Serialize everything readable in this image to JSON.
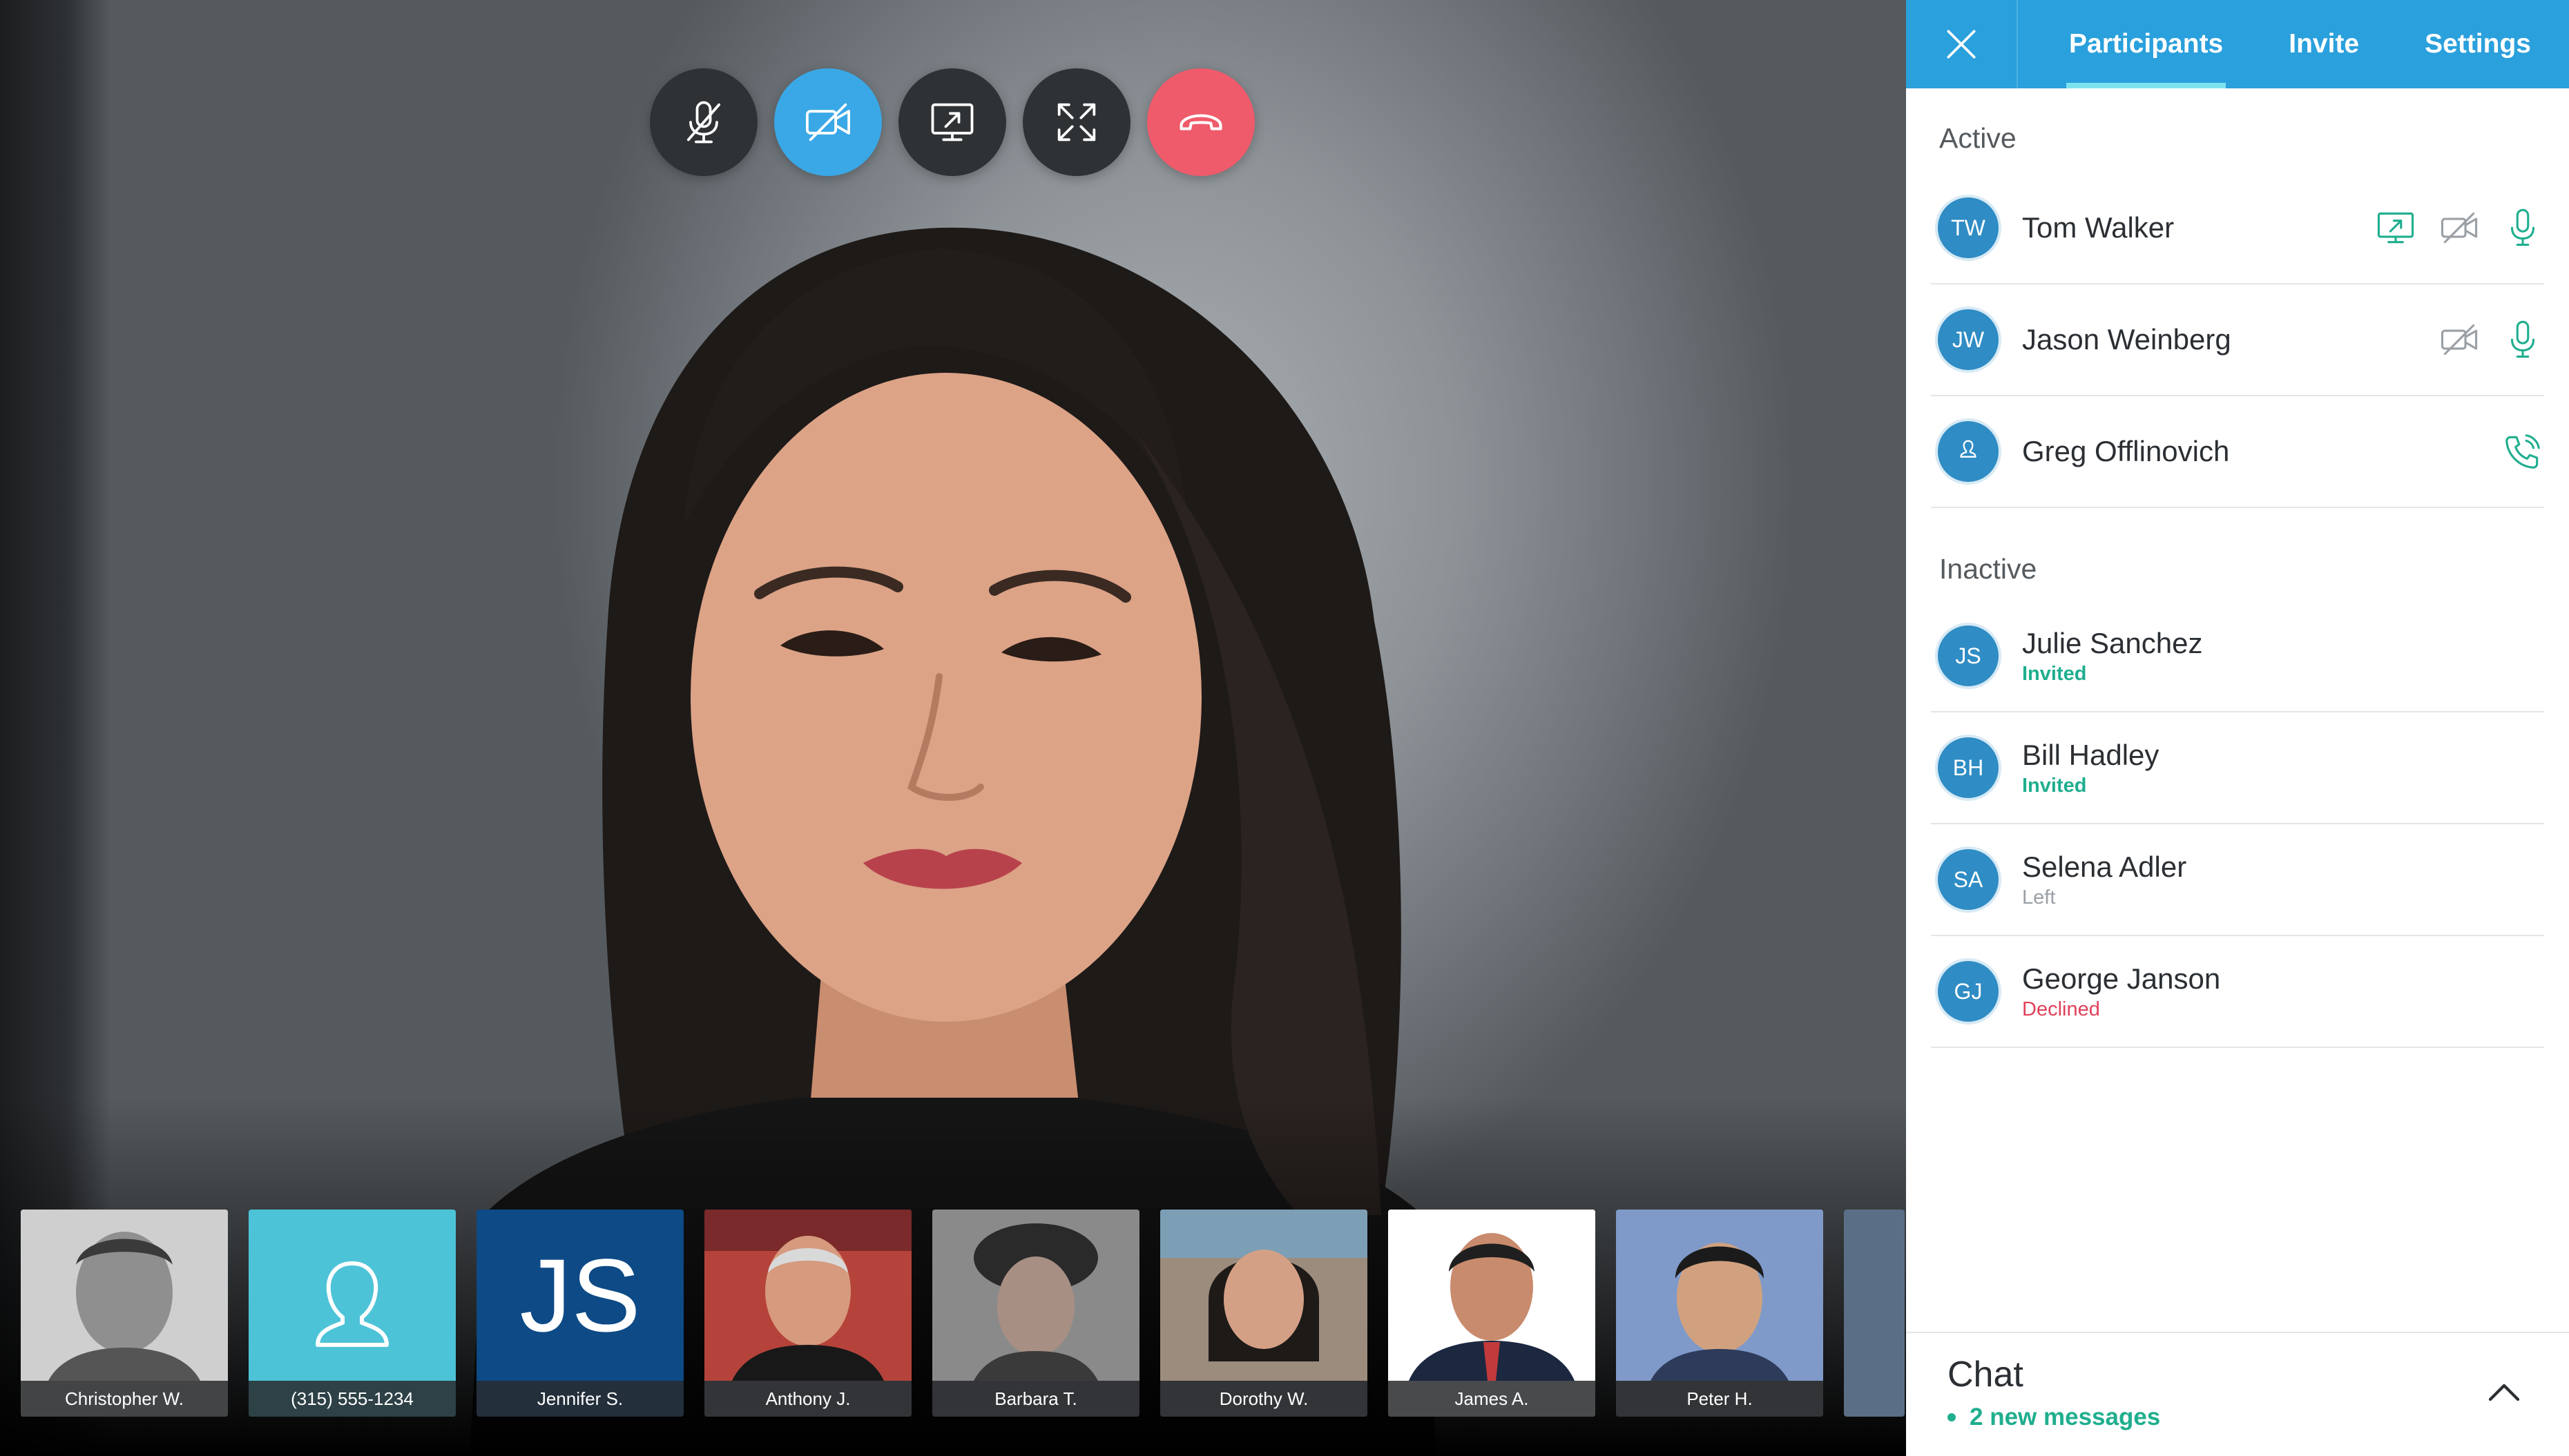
{
  "colors": {
    "accent": "#2aa0dc",
    "active_control": "#3aa8e6",
    "hangup": "#ef5b6b",
    "status_invited": "#1fae8e",
    "status_declined": "#e0415a",
    "status_left": "#9aa0a5",
    "mic_green": "#1fae8e"
  },
  "call_controls": [
    {
      "icon": "mic-off-icon",
      "state": "inactive"
    },
    {
      "icon": "camera-off-icon",
      "state": "active"
    },
    {
      "icon": "screen-share-icon",
      "state": "inactive"
    },
    {
      "icon": "fullscreen-icon",
      "state": "inactive"
    },
    {
      "icon": "hangup-icon",
      "state": "hangup"
    }
  ],
  "thumbnails": [
    {
      "label": "Christopher W.",
      "type": "photo"
    },
    {
      "label": "(315) 555-1234",
      "type": "phone",
      "icon": "user-outline-icon"
    },
    {
      "label": "Jennifer S.",
      "type": "initials",
      "initials": "JS"
    },
    {
      "label": "Anthony J.",
      "type": "photo"
    },
    {
      "label": "Barbara T.",
      "type": "photo"
    },
    {
      "label": "Dorothy W.",
      "type": "photo"
    },
    {
      "label": "James A.",
      "type": "photo"
    },
    {
      "label": "Peter H.",
      "type": "photo"
    }
  ],
  "panel": {
    "close_icon": "close-icon",
    "tabs": [
      {
        "label": "Participants",
        "selected": true
      },
      {
        "label": "Invite",
        "selected": false
      },
      {
        "label": "Settings",
        "selected": false
      }
    ],
    "active_heading": "Active",
    "inactive_heading": "Inactive",
    "active": [
      {
        "initials": "TW",
        "name": "Tom Walker",
        "icons": [
          "screen-share-icon",
          "camera-off-icon",
          "mic-icon"
        ]
      },
      {
        "initials": "JW",
        "name": "Jason Weinberg",
        "icons": [
          "camera-off-icon",
          "mic-icon"
        ]
      },
      {
        "initials": "",
        "name": "Greg Offlinovich",
        "avatar_icon": "user-outline-icon",
        "icons": [
          "phone-icon"
        ]
      }
    ],
    "inactive": [
      {
        "initials": "JS",
        "name": "Julie Sanchez",
        "status": "Invited"
      },
      {
        "initials": "BH",
        "name": "Bill Hadley",
        "status": "Invited"
      },
      {
        "initials": "SA",
        "name": "Selena Adler",
        "status": "Left"
      },
      {
        "initials": "GJ",
        "name": "George Janson",
        "status": "Declined"
      }
    ],
    "chat": {
      "title": "Chat",
      "subtitle": "2 new messages",
      "toggle_icon": "chevron-up-icon"
    }
  }
}
